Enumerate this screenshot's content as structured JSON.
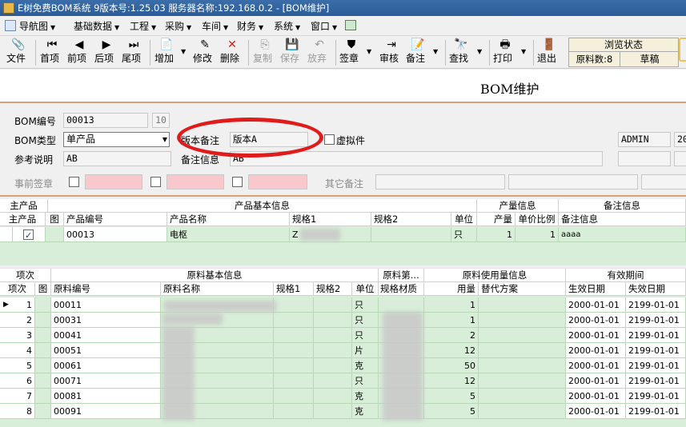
{
  "window": {
    "title": "E树免费BOM系统 9版本号:1.25.03  服务器名称:192.168.0.2 - [BOM维护]"
  },
  "menu": [
    "导航图",
    "基础数据",
    "工程",
    "采购",
    "车间",
    "财务",
    "系统",
    "窗口"
  ],
  "toolbar": {
    "file": "文件",
    "first": "首项",
    "prev": "前项",
    "next": "后项",
    "last": "尾项",
    "add": "增加",
    "edit": "修改",
    "delete": "删除",
    "copy": "复制",
    "save": "保存",
    "discard": "放弃",
    "sign": "签章",
    "approve": "审核",
    "note": "备注",
    "find": "查找",
    "print": "打印",
    "exit": "退出"
  },
  "status": {
    "header": "浏览状态",
    "material_count": "原料数:8",
    "state": "草稿"
  },
  "page_title": "BOM维护",
  "form": {
    "bom_no_label": "BOM编号",
    "bom_no": "00013",
    "bom_no_extra": "10",
    "bom_type_label": "BOM类型",
    "bom_type": "单产品",
    "ref_label": "参考说明",
    "ref": "AB",
    "version_note_label": "版本备注",
    "version_note": "版本A",
    "virtual_label": "虚拟件",
    "remark_label": "备注信息",
    "remark": "AB",
    "pre_sign_label": "事前签章",
    "other_note_label": "其它备注",
    "user": "ADMIN",
    "date_prefix": "20"
  },
  "grid1": {
    "groups": [
      "主产品",
      "产品基本信息",
      "产量信息",
      "备注信息"
    ],
    "columns": [
      "主产品",
      "图",
      "产品编号",
      "产品名称",
      "规格1",
      "规格2",
      "单位",
      "产量",
      "单价比例",
      "备注信息"
    ],
    "row": {
      "main": true,
      "code": "00013",
      "name": "电枢",
      "spec1": "Z",
      "unit": "只",
      "qty": "1",
      "ratio": "1",
      "note": "aaaa"
    }
  },
  "grid2": {
    "groups": [
      "项次",
      "原料基本信息",
      "原料第...",
      "原料使用量信息",
      "有效期间"
    ],
    "columns": [
      "项次",
      "图",
      "原料编号",
      "原料名称",
      "规格1",
      "规格2",
      "单位",
      "规格材质",
      "用量",
      "替代方案",
      "生效日期",
      "失效日期"
    ],
    "rows": [
      {
        "no": "1",
        "code": "00011",
        "unit": "只",
        "qty": "1",
        "start": "2000-01-01",
        "end": "2199-01-01"
      },
      {
        "no": "2",
        "code": "00031",
        "unit": "只",
        "qty": "1",
        "start": "2000-01-01",
        "end": "2199-01-01"
      },
      {
        "no": "3",
        "code": "00041",
        "unit": "只",
        "qty": "2",
        "start": "2000-01-01",
        "end": "2199-01-01"
      },
      {
        "no": "4",
        "code": "00051",
        "unit": "片",
        "qty": "12",
        "start": "2000-01-01",
        "end": "2199-01-01"
      },
      {
        "no": "5",
        "code": "00061",
        "unit": "克",
        "qty": "50",
        "start": "2000-01-01",
        "end": "2199-01-01"
      },
      {
        "no": "6",
        "code": "00071",
        "unit": "只",
        "qty": "12",
        "start": "2000-01-01",
        "end": "2199-01-01"
      },
      {
        "no": "7",
        "code": "00081",
        "unit": "克",
        "qty": "5",
        "start": "2000-01-01",
        "end": "2199-01-01"
      },
      {
        "no": "8",
        "code": "00091",
        "unit": "克",
        "qty": "5",
        "start": "2000-01-01",
        "end": "2199-01-01"
      }
    ]
  }
}
